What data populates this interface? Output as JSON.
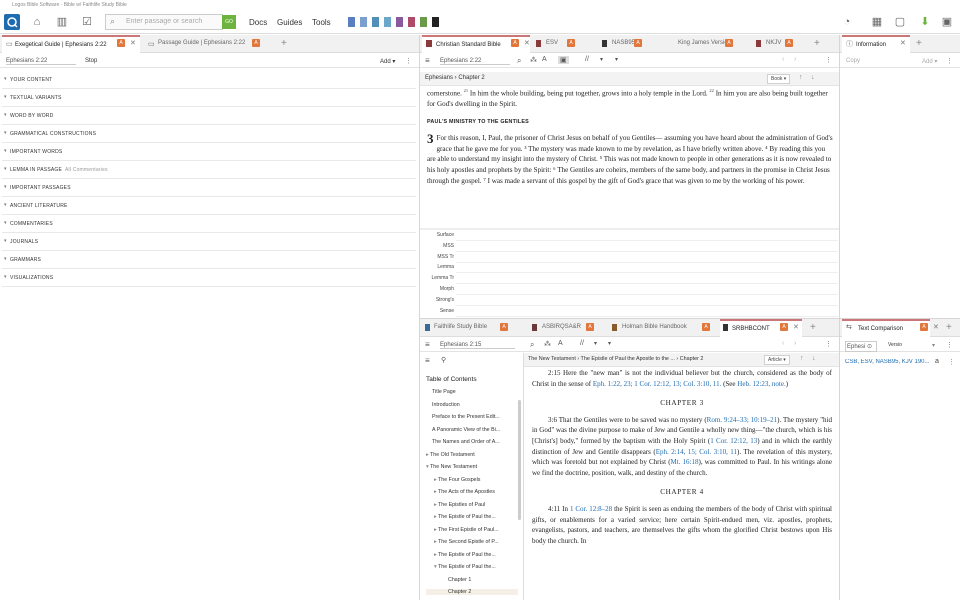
{
  "window": {
    "title": "Logos Bible Software · Bible w/ Faithlife Study Bible"
  },
  "toolbar": {
    "search_placeholder": "Enter passage or search",
    "go_label": "GO",
    "menus": [
      "Docs",
      "Guides",
      "Tools"
    ],
    "layout_colors": [
      "#5a7fc0",
      "#7aa0d0",
      "#4f8fb8",
      "#6aa7c9",
      "#8a5aa0",
      "#b04a6a",
      "#6a9a4a",
      "#222222"
    ]
  },
  "left_panel": {
    "tabs": [
      {
        "label": "Exegetical Guide | Ephesians 2:22",
        "active": true
      },
      {
        "label": "Passage Guide | Ephesians 2:22",
        "active": false
      }
    ],
    "reference": "Ephesians 2:22",
    "stop_label": "Stop",
    "add_label": "Add",
    "sections": [
      {
        "label": "YOUR CONTENT",
        "note": ""
      },
      {
        "label": "TEXTUAL VARIANTS",
        "note": ""
      },
      {
        "label": "WORD BY WORD",
        "note": ""
      },
      {
        "label": "GRAMMATICAL CONSTRUCTIONS",
        "note": ""
      },
      {
        "label": "IMPORTANT WORDS",
        "note": ""
      },
      {
        "label": "LEMMA IN PASSAGE",
        "note": "All Commentaries"
      },
      {
        "label": "IMPORTANT PASSAGES",
        "note": ""
      },
      {
        "label": "ANCIENT LITERATURE",
        "note": ""
      },
      {
        "label": "COMMENTARIES",
        "note": ""
      },
      {
        "label": "JOURNALS",
        "note": ""
      },
      {
        "label": "GRAMMARS",
        "note": ""
      },
      {
        "label": "VISUALIZATIONS",
        "note": ""
      }
    ]
  },
  "bible_panel": {
    "tabs": [
      {
        "label": "Christian Standard Bible",
        "active": true
      },
      {
        "label": "ESV",
        "active": false
      },
      {
        "label": "NASB95",
        "active": false
      },
      {
        "label": "King James Version",
        "active": false
      },
      {
        "label": "NKJV",
        "active": false
      }
    ],
    "reference": "Ephesians 2:22",
    "breadcrumb": "Ephesians › Chapter 2",
    "book_button": "Book",
    "text": {
      "p1a": "cornerstone.",
      "v21": "21",
      "p1b": " In him the whole building, being put together, grows into a holy temple in the Lord.",
      "v22": "22",
      "p1c": " In him you are also being built together for God's dwelling in the Spirit.",
      "heading": "PAUL'S MINISTRY TO THE GENTILES",
      "chapter": "3",
      "p2": "For this reason, I, Paul, the prisoner of Christ Jesus on behalf of you Gentiles— assuming you have heard about the administration of God's grace that he gave me for you. ³ The mystery was made known to me by revelation, as I have briefly written above. ⁴ By reading this you are able to understand my insight into the mystery of Christ. ⁵ This was not made known to people in other generations as it is now revealed to his holy apostles and prophets by the Spirit: ⁶ The Gentiles are coheirs, members of the same body, and partners in the promise in Christ Jesus through the gospel. ⁷ I was made a servant of this gospel by the gift of God's grace that was given to me by the working of his power."
    },
    "interlinear_rows": [
      "Surface",
      "MSS",
      "MSS Tr",
      "Lemma",
      "Lemma Tr",
      "Morph",
      "Strong's",
      "Sense"
    ]
  },
  "info_panel": {
    "tab": "Information",
    "copy_label": "Copy",
    "add_label": "Add"
  },
  "study_panel": {
    "tabs": [
      {
        "label": "Faithlife Study Bible",
        "active": false
      },
      {
        "label": "ASBIRQSA&R",
        "active": false
      },
      {
        "label": "Holman Bible Handbook",
        "active": false
      },
      {
        "label": "SRBHBCONT",
        "active": true
      }
    ],
    "reference": "Ephesians 2:15",
    "breadcrumb": "The New Testament › The Epistle of Paul the Apostle to the ... › Chapter 2",
    "article_button": "Article",
    "toc_title": "Table of Contents",
    "toc": [
      {
        "label": "Title Page",
        "indent": 0,
        "exp": ""
      },
      {
        "label": "Introduction",
        "indent": 0,
        "exp": ""
      },
      {
        "label": "Preface to the Present Edit...",
        "indent": 0,
        "exp": ""
      },
      {
        "label": "A Panoramic View of the Bi...",
        "indent": 0,
        "exp": ""
      },
      {
        "label": "The Names and Order of A...",
        "indent": 0,
        "exp": ""
      },
      {
        "label": "The Old Testament",
        "indent": 0,
        "exp": "▸"
      },
      {
        "label": "The New Testament",
        "indent": 0,
        "exp": "▾"
      },
      {
        "label": "The Four Gospels",
        "indent": 1,
        "exp": "▸"
      },
      {
        "label": "The Acts of the Apostles",
        "indent": 1,
        "exp": "▸"
      },
      {
        "label": "The Epistles of Paul",
        "indent": 1,
        "exp": "▸"
      },
      {
        "label": "The Epistle of Paul the...",
        "indent": 1,
        "exp": "▸"
      },
      {
        "label": "The First Epistle of Paul...",
        "indent": 1,
        "exp": "▸"
      },
      {
        "label": "The Second Epistle of P...",
        "indent": 1,
        "exp": "▸"
      },
      {
        "label": "The Epistle of Paul the...",
        "indent": 1,
        "exp": "▸"
      },
      {
        "label": "The Epistle of Paul the...",
        "indent": 1,
        "exp": "▾"
      },
      {
        "label": "Chapter 1",
        "indent": 2,
        "exp": ""
      },
      {
        "label": "Chapter 2",
        "indent": 2,
        "exp": ""
      }
    ],
    "commentary": {
      "c1a": "2:15 Here the \"new man\" is not the individual believer but the church, considered as the body of Christ in the sense of ",
      "c1ref": "Eph. 1:22, 23; 1 Cor. 12:12, 13; Col. 3:10, 11.",
      "c1b": " (See ",
      "c1ref2": "Heb. 12:23, note.",
      "c1c": ")",
      "chapter3": "CHAPTER 3",
      "c2a": "3:6 That the Gentiles were to be saved was no mystery (",
      "c2ref": "Rom. 9:24–33; 10:19–21",
      "c2b": "). The mystery \"hid in God\" was the divine purpose to make of Jew and Gentile a wholly new thing—\"the church, which is his [Christ's] body,\" formed by the baptism with the Holy Spirit (",
      "c2ref2": "1 Cor. 12:12, 13",
      "c2c": ") and in which the earthly distinction of Jew and Gentile disappears (",
      "c2ref3": "Eph. 2:14, 15; Col. 3:10, 11",
      "c2d": "). The revelation of this mystery, which was foretold but not explained by Christ (",
      "c2ref4": "Mt. 16:18",
      "c2e": "), was committed to Paul. In his writings alone we find the doctrine, position, walk, and destiny of the church.",
      "chapter4": "CHAPTER 4",
      "c3a": "4:11 In ",
      "c3ref": "1 Cor. 12:8–28",
      "c3b": " the Spirit is seen as enduing the members of the body of Christ with spiritual gifts, or enablements for a varied service; here certain Spirit-endued men, viz. apostles, prophets, evangelists, pastors, and teachers, are themselves the gifts whom the glorified Christ bestows upon His body the church. In"
    }
  },
  "compare_panel": {
    "tab": "Text Comparison",
    "reference": "Ephesi",
    "version_label": "Versio",
    "versions": "CSB, ESV, NASB95, KJV 190...",
    "mode_glyph": "a"
  }
}
